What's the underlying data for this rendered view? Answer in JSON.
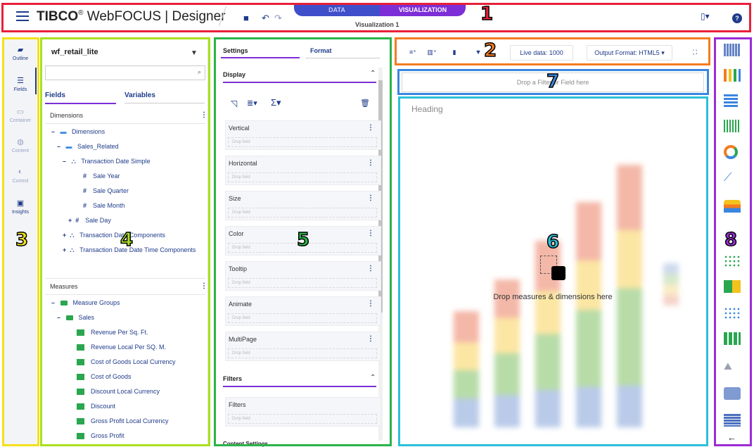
{
  "header": {
    "brand_tibco": "TIBCO",
    "brand_rest": "WebFOCUS | Designer",
    "tab_data": "DATA",
    "tab_visualization": "VISUALIZATION",
    "visualization_title": "Visualization 1",
    "help_label": "?"
  },
  "left_nav": [
    {
      "label": "Outline",
      "icon": "hierarchy-icon"
    },
    {
      "label": "Fields",
      "icon": "list-icon"
    },
    {
      "label": "Container",
      "icon": "container-icon"
    },
    {
      "label": "Content",
      "icon": "globe-icon"
    },
    {
      "label": "Control",
      "icon": "toggle-icon"
    },
    {
      "label": "Insights",
      "icon": "insights-icon"
    }
  ],
  "fields_panel": {
    "data_source": "wf_retail_lite",
    "search_placeholder": "",
    "tab_fields": "Fields",
    "tab_variables": "Variables",
    "dimensions_header": "Dimensions",
    "measures_header": "Measures",
    "dimension_tree": [
      {
        "label": "Dimensions",
        "toggle": "–"
      },
      {
        "label": "Sales_Related",
        "toggle": "–"
      },
      {
        "label": "Transaction Date Simple",
        "toggle": "–"
      },
      {
        "label": "Sale Year"
      },
      {
        "label": "Sale Quarter"
      },
      {
        "label": "Sale Month"
      },
      {
        "label": "Sale Day",
        "toggle": "+"
      },
      {
        "label": "Transaction Date Components",
        "toggle": "+"
      },
      {
        "label": "Transaction Date Date Time Components",
        "toggle": "+"
      }
    ],
    "measure_tree": [
      {
        "label": "Measure Groups",
        "toggle": "–"
      },
      {
        "label": "Sales",
        "toggle": "–"
      },
      {
        "label": "Revenue Per Sq. Ft."
      },
      {
        "label": "Revenue Local Per SQ. M."
      },
      {
        "label": "Cost of Goods Local Currency"
      },
      {
        "label": "Cost of Goods"
      },
      {
        "label": "Discount Local Currency"
      },
      {
        "label": "Discount"
      },
      {
        "label": "Gross Profit Local Currency"
      },
      {
        "label": "Gross Profit"
      }
    ]
  },
  "settings_panel": {
    "tab_settings": "Settings",
    "tab_format": "Format",
    "display_header": "Display",
    "buckets": [
      "Vertical",
      "Horizontal",
      "Size",
      "Color",
      "Tooltip",
      "Animate",
      "MultiPage"
    ],
    "drop_field": "Drop field",
    "filters_header": "Filters",
    "filters_bucket": "Filters",
    "content_settings": "Content Settings"
  },
  "toolbar": {
    "live_data": "Live data: 1000",
    "output_format": "Output Format: HTML5"
  },
  "canvas": {
    "filter_drop": "Drop a Filter or Field here",
    "heading": "Heading",
    "drop_hint": "Drop measures & dimensions here"
  },
  "callouts": [
    "1",
    "2",
    "3",
    "4",
    "5",
    "6",
    "7",
    "8"
  ],
  "colors": {
    "brand_blue": "#1f3b8a",
    "data_tab": "#3f4fc9",
    "vis_tab": "#7d2ed6",
    "frame_1": "#e8203a",
    "frame_2": "#f47c20",
    "frame_3": "#f3e01c",
    "frame_4": "#a9e021",
    "frame_5": "#2ab34a",
    "frame_6": "#2bc0d9",
    "frame_7": "#3a86e0",
    "frame_8": "#9b2bd6"
  }
}
